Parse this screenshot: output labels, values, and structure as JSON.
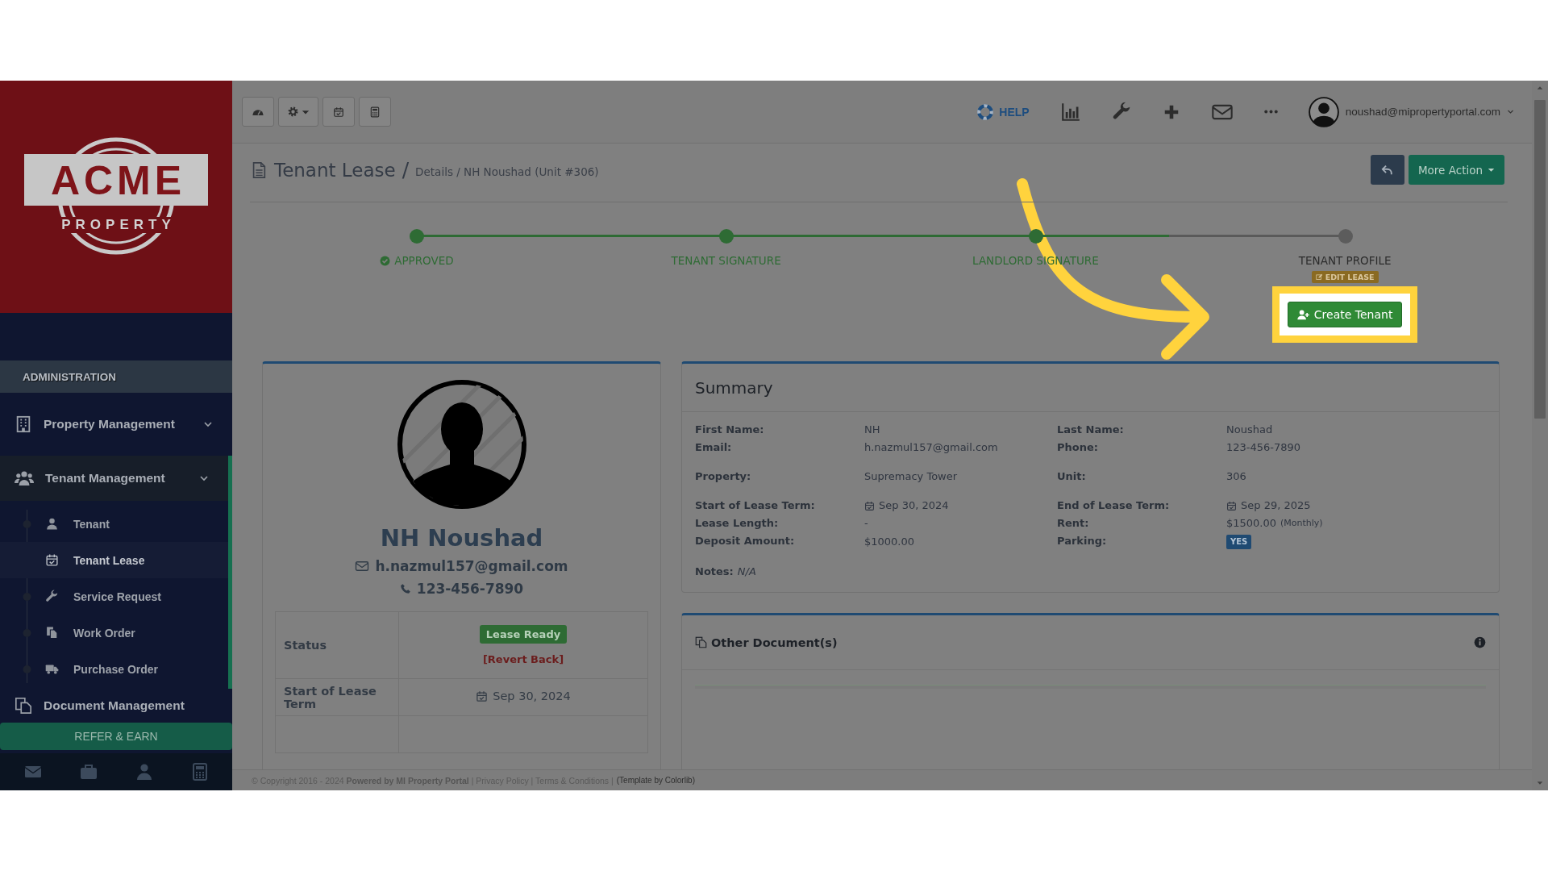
{
  "sidebar": {
    "logo": {
      "name": "ACME",
      "tagline": "PROPERTY"
    },
    "section_title": "ADMINISTRATION",
    "items": [
      {
        "label": "Property Management",
        "has_menu": true,
        "expanded": false
      },
      {
        "label": "Tenant Management",
        "has_menu": true,
        "expanded": true,
        "children": [
          {
            "label": "Tenant",
            "selected": false
          },
          {
            "label": "Tenant Lease",
            "selected": true
          },
          {
            "label": "Service Request",
            "selected": false
          },
          {
            "label": "Work Order",
            "selected": false
          },
          {
            "label": "Purchase Order",
            "selected": false
          }
        ]
      },
      {
        "label": "Document Management",
        "has_menu": false,
        "expanded": false
      }
    ],
    "refer_button": "REFER & EARN"
  },
  "topbar": {
    "help": "HELP",
    "user_email": "noushad@mipropertyportal.com"
  },
  "header": {
    "title": "Tenant Lease",
    "separator": "/",
    "breadcrumb": "Details / NH Noushad (Unit #306)",
    "more_action": "More Action"
  },
  "progress": {
    "level": 0.81,
    "steps": [
      {
        "label": "APPROVED",
        "done": true,
        "checked": true
      },
      {
        "label": "TENANT SIGNATURE",
        "done": true,
        "checked": false
      },
      {
        "label": "LANDLORD SIGNATURE",
        "done": true,
        "checked": false
      },
      {
        "label": "TENANT PROFILE",
        "done": false,
        "checked": false,
        "badge": "EDIT LEASE"
      }
    ]
  },
  "create_tenant": {
    "label": "Create Tenant",
    "highlighted": true
  },
  "profile": {
    "name": "NH Noushad",
    "email": "h.nazmul157@gmail.com",
    "phone": "123-456-7890",
    "rows": [
      {
        "label": "Status",
        "kind": "status",
        "badge": "Lease Ready",
        "link": "[Revert Back]"
      },
      {
        "label": "Start of Lease Term",
        "kind": "date",
        "value": "Sep 30, 2024"
      }
    ]
  },
  "summary": {
    "title": "Summary",
    "groups": [
      [
        {
          "label": "First Name:",
          "value": "NH",
          "kind": "text"
        },
        {
          "label": "Last Name:",
          "value": "Noushad",
          "kind": "text"
        },
        {
          "label": "Email:",
          "value": "h.nazmul157@gmail.com",
          "kind": "text"
        },
        {
          "label": "Phone:",
          "value": "123-456-7890",
          "kind": "text"
        }
      ],
      [
        {
          "label": "Property:",
          "value": "Supremacy Tower",
          "kind": "text"
        },
        {
          "label": "Unit:",
          "value": "306",
          "kind": "text"
        }
      ],
      [
        {
          "label": "Start of Lease Term:",
          "value": "Sep 30, 2024",
          "kind": "date"
        },
        {
          "label": "End of Lease Term:",
          "value": "Sep 29, 2025",
          "kind": "date"
        },
        {
          "label": "Lease Length:",
          "value": "-",
          "kind": "text"
        },
        {
          "label": "Rent:",
          "value": "$1500.00",
          "kind": "text",
          "note": "(Monthly)"
        },
        {
          "label": "Deposit Amount:",
          "value": "$1000.00",
          "kind": "text"
        },
        {
          "label": "Parking:",
          "value": "YES",
          "kind": "badge"
        }
      ]
    ],
    "notes_label": "Notes:",
    "notes_value": "N/A"
  },
  "documents": {
    "title": "Other Document(s)"
  },
  "footer": {
    "text": "© Copyright 2016 - 2024 **Powered by MI Property Portal** | Privacy Policy | Terms & Conditions |",
    "credit": "(Template by Colorlib)"
  }
}
